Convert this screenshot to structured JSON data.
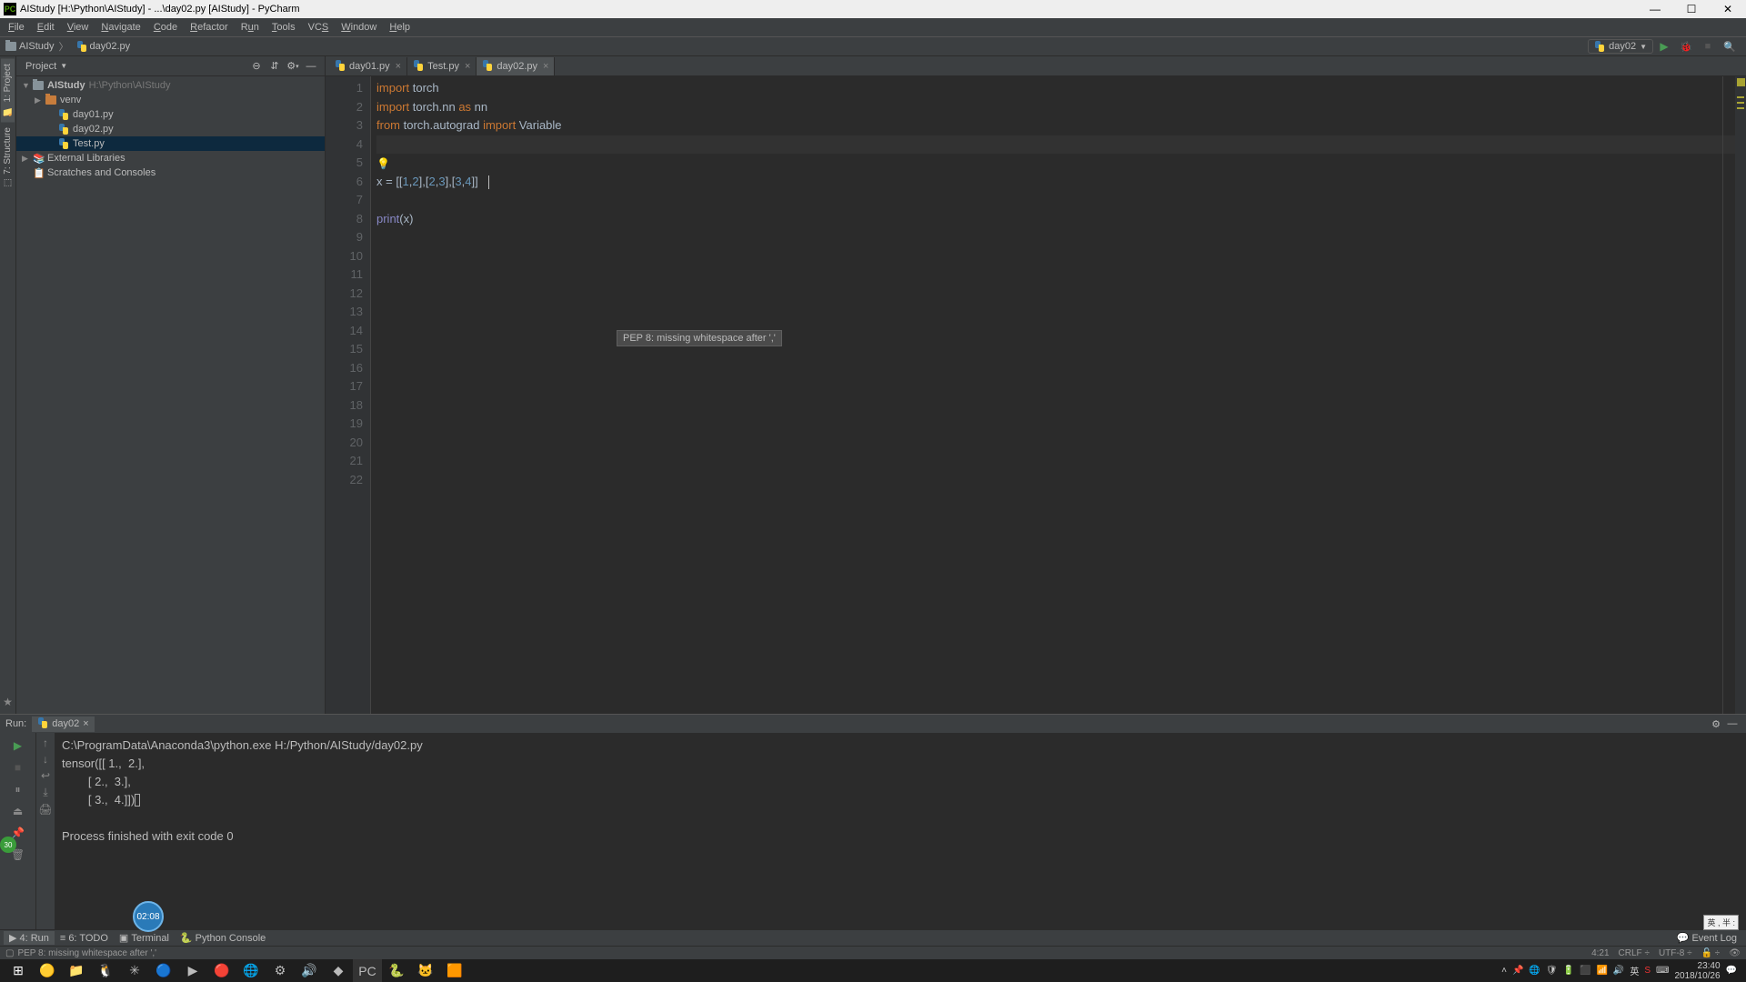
{
  "titlebar": {
    "text": "AIStudy [H:\\Python\\AIStudy] - ...\\day02.py [AIStudy] - PyCharm"
  },
  "menu": {
    "items": [
      "File",
      "Edit",
      "View",
      "Navigate",
      "Code",
      "Refactor",
      "Run",
      "Tools",
      "VCS",
      "Window",
      "Help"
    ]
  },
  "nav": {
    "crumb1": "AIStudy",
    "crumb2": "day02.py",
    "run_config": "day02"
  },
  "project": {
    "title": "Project",
    "root": "AIStudy",
    "root_path": "H:\\Python\\AIStudy",
    "venv": "venv",
    "files": [
      "day01.py",
      "day02.py",
      "Test.py"
    ],
    "ext_lib": "External Libraries",
    "scratches": "Scratches and Consoles"
  },
  "tabs": [
    {
      "name": "day01.py",
      "active": false
    },
    {
      "name": "Test.py",
      "active": false
    },
    {
      "name": "day02.py",
      "active": true
    }
  ],
  "code": {
    "line1_kw": "import",
    "line1_rest": " torch",
    "line2_kw": "import",
    "line2_mid": " torch.nn ",
    "line2_as": "as",
    "line2_alias": " nn",
    "line3_from": "from",
    "line3_mod": " torch.autograd ",
    "line3_imp": "import",
    "line3_name": " Variable",
    "line6_var": "x = [[",
    "line6_n1": "1",
    "line6_c": ",",
    "line6_n2": "2",
    "line6_b": "],[",
    "line6_n3": "2",
    "line6_n4": "3",
    "line6_b2": "],[",
    "line6_n5": "3",
    "line6_n6": "4",
    "line6_end": "]]",
    "line8_fn": "print",
    "line8_paren": "(x)",
    "tooltip": "PEP 8: missing whitespace after ','",
    "line_numbers": [
      "1",
      "2",
      "3",
      "4",
      "5",
      "6",
      "7",
      "8",
      "9",
      "10",
      "11",
      "12",
      "13",
      "14",
      "15",
      "16",
      "17",
      "18",
      "19",
      "20",
      "21",
      "22"
    ]
  },
  "run": {
    "label": "Run:",
    "tab": "day02",
    "out1": "C:\\ProgramData\\Anaconda3\\python.exe H:/Python/AIStudy/day02.py",
    "out2": "tensor([[ 1.,  2.],",
    "out3": "        [ 2.,  3.],",
    "out4": "        [ 3.,  4.]])",
    "out5": "",
    "out6": "Process finished with exit code 0"
  },
  "bottom": {
    "run": "4: Run",
    "todo": "6: TODO",
    "terminal": "Terminal",
    "pyconsole": "Python Console",
    "eventlog": "Event Log"
  },
  "status": {
    "msg": "PEP 8: missing whitespace after ','",
    "pos": "4:21",
    "crlf": "CRLF",
    "enc": "UTF-8",
    "lock": "🔒"
  },
  "side": {
    "project": "1: Project",
    "structure": "7: Structure"
  },
  "bubble": {
    "time": "02:08"
  },
  "ime": {
    "text": "英 , 半 :"
  },
  "taskbar": {
    "time": "23:40",
    "date": "2018/10/26",
    "lang": "英"
  }
}
